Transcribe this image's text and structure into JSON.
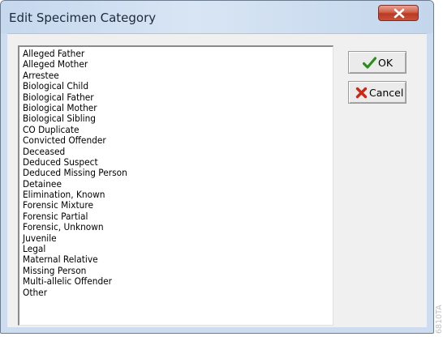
{
  "window": {
    "title": "Edit Specimen Category",
    "close_icon": "close-x-icon"
  },
  "categories": [
    "Alleged Father",
    "Alleged Mother",
    "Arrestee",
    "Biological Child",
    "Biological Father",
    "Biological Mother",
    "Biological Sibling",
    "CO Duplicate",
    "Convicted Offender",
    "Deceased",
    "Deduced Suspect",
    "Deduced Missing Person",
    "Detainee",
    "Elimination, Known",
    "Forensic Mixture",
    "Forensic Partial",
    "Forensic, Unknown",
    "Juvenile",
    "Legal",
    "Maternal Relative",
    "Missing Person",
    "Multi-allelic Offender",
    "Other"
  ],
  "buttons": {
    "ok": {
      "label": "OK",
      "icon": "checkmark-icon",
      "icon_color": "#2e8b1e"
    },
    "cancel": {
      "label": "Cancel",
      "icon": "red-x-icon",
      "icon_color": "#d62412"
    }
  },
  "figure_id": "6810TA",
  "colors": {
    "window_frame": "#cddcee",
    "client_background": "#f0f0f0",
    "close_button": "#c9503a"
  }
}
